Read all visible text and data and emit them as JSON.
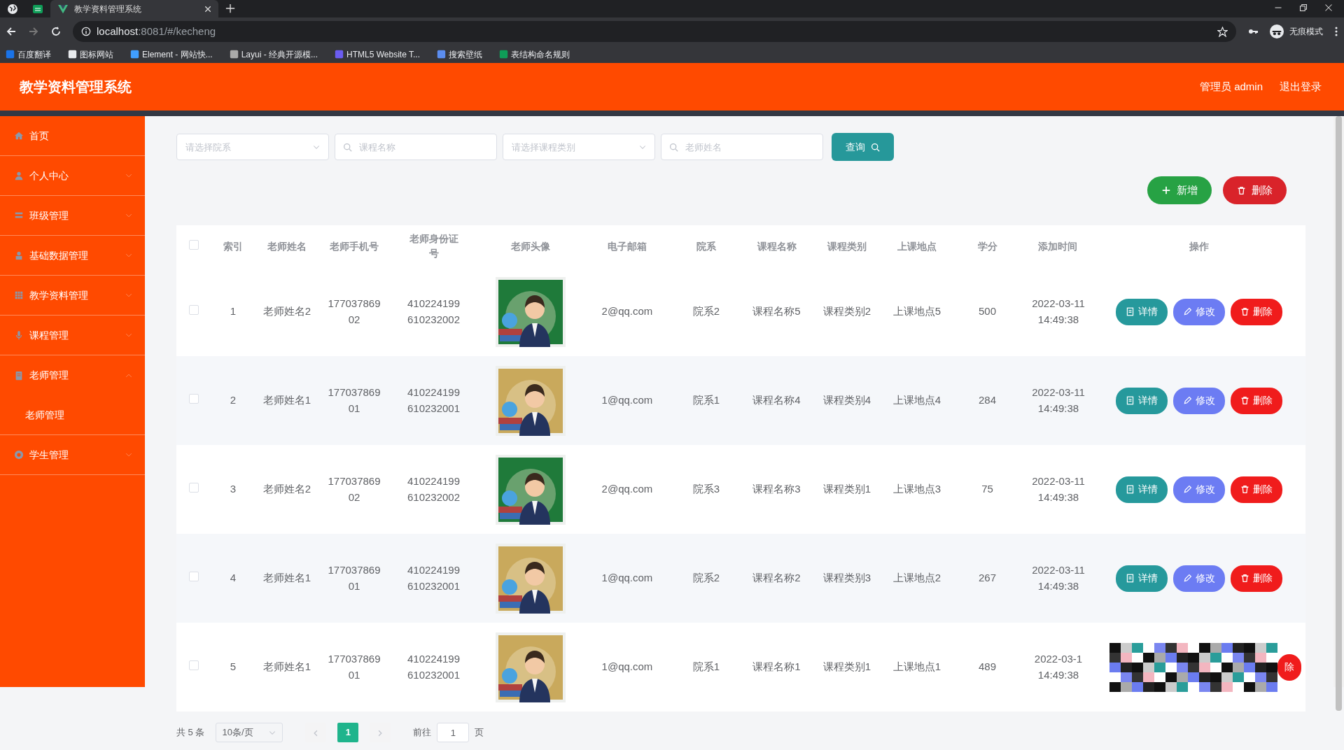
{
  "browser": {
    "tabs": [
      {
        "kind": "pinned",
        "selected": false
      },
      {
        "kind": "pinned",
        "selected": false
      },
      {
        "kind": "page",
        "title": "教学资料管理系统",
        "selected": true
      }
    ],
    "url_host": "localhost",
    "url_path": ":8081/#/kecheng",
    "profile": "无痕模式",
    "bookmarks": [
      "百度翻译",
      "图标网站",
      "Element - 网站快...",
      "Layui - 经典开源模...",
      "HTML5 Website T...",
      "搜索壁纸",
      "表结构命名规则"
    ]
  },
  "app": {
    "title": "教学资料管理系统",
    "user": "管理员 admin",
    "logout": "退出登录"
  },
  "sidebar": {
    "items": [
      {
        "label": "首页",
        "kind": "link"
      },
      {
        "label": "个人中心",
        "kind": "menu",
        "expanded": false
      },
      {
        "label": "班级管理",
        "kind": "menu",
        "expanded": false
      },
      {
        "label": "基础数据管理",
        "kind": "menu",
        "expanded": false
      },
      {
        "label": "教学资料管理",
        "kind": "menu",
        "expanded": false
      },
      {
        "label": "课程管理",
        "kind": "menu",
        "expanded": false
      },
      {
        "label": "老师管理",
        "kind": "menu",
        "expanded": true,
        "children": [
          {
            "label": "老师管理"
          }
        ]
      },
      {
        "label": "学生管理",
        "kind": "menu",
        "expanded": false
      }
    ]
  },
  "filters": [
    {
      "kind": "select",
      "placeholder": "请选择院系"
    },
    {
      "kind": "search",
      "placeholder": "课程名称"
    },
    {
      "kind": "select",
      "placeholder": "请选择课程类别"
    },
    {
      "kind": "search",
      "placeholder": "老师姓名"
    }
  ],
  "query_button": "查询",
  "toolbar": {
    "add": "新增",
    "delete": "删除"
  },
  "table": {
    "header_checked": false,
    "columns": [
      "索引",
      "老师姓名",
      "老师手机号",
      "老师身份证号",
      "老师头像",
      "电子邮箱",
      "院系",
      "课程名称",
      "课程类别",
      "上课地点",
      "学分",
      "添加时间",
      "操作"
    ],
    "rows": [
      {
        "checked": false,
        "index": "1",
        "name": "老师姓名2",
        "phone": "17703786902",
        "id_card": "410224199610232002",
        "avatar": {
          "kind": "picture",
          "color": "#1f7a3a"
        },
        "email": "2@qq.com",
        "department": "院系2",
        "course_name": "课程名称5",
        "course_type": "课程类别2",
        "location": "上课地点5",
        "credits": "500",
        "added": "2022-03-11 14:49:38",
        "actions": [
          {
            "kind": "detail",
            "label": "详情"
          },
          {
            "kind": "edit",
            "label": "修改"
          },
          {
            "kind": "delete",
            "label": "删除"
          }
        ]
      },
      {
        "checked": false,
        "index": "2",
        "name": "老师姓名1",
        "phone": "17703786901",
        "id_card": "410224199610232001",
        "avatar": {
          "kind": "picture",
          "color": "#c9a95c"
        },
        "email": "1@qq.com",
        "department": "院系1",
        "course_name": "课程名称4",
        "course_type": "课程类别4",
        "location": "上课地点4",
        "credits": "284",
        "added": "2022-03-11 14:49:38",
        "actions": [
          {
            "kind": "detail",
            "label": "详情"
          },
          {
            "kind": "edit",
            "label": "修改"
          },
          {
            "kind": "delete",
            "label": "删除"
          }
        ]
      },
      {
        "checked": false,
        "index": "3",
        "name": "老师姓名2",
        "phone": "17703786902",
        "id_card": "410224199610232002",
        "avatar": {
          "kind": "picture",
          "color": "#1f7a3a"
        },
        "email": "2@qq.com",
        "department": "院系3",
        "course_name": "课程名称3",
        "course_type": "课程类别1",
        "location": "上课地点3",
        "credits": "75",
        "added": "2022-03-11 14:49:38",
        "actions": [
          {
            "kind": "detail",
            "label": "详情"
          },
          {
            "kind": "edit",
            "label": "修改"
          },
          {
            "kind": "delete",
            "label": "删除"
          }
        ]
      },
      {
        "checked": false,
        "index": "4",
        "name": "老师姓名1",
        "phone": "17703786901",
        "id_card": "410224199610232001",
        "avatar": {
          "kind": "picture",
          "color": "#c9a95c"
        },
        "email": "1@qq.com",
        "department": "院系2",
        "course_name": "课程名称2",
        "course_type": "课程类别3",
        "location": "上课地点2",
        "credits": "267",
        "added": "2022-03-11 14:49:38",
        "actions": [
          {
            "kind": "detail",
            "label": "详情"
          },
          {
            "kind": "edit",
            "label": "修改"
          },
          {
            "kind": "delete",
            "label": "删除"
          }
        ]
      },
      {
        "checked": false,
        "index": "5",
        "name": "老师姓名1",
        "phone": "17703786901",
        "id_card": "410224199610232001",
        "avatar": {
          "kind": "picture",
          "color": "#c9a95c"
        },
        "email": "1@qq.com",
        "department": "院系1",
        "course_name": "课程名称1",
        "course_type": "课程类别1",
        "location": "上课地点1",
        "credits": "489",
        "added": "2022-03-1 14:49:38",
        "obscured": true,
        "actions": [
          {
            "kind": "delete",
            "label": "除"
          }
        ]
      }
    ]
  },
  "pagination": {
    "total": "共 5 条",
    "page_size": "10条/页",
    "pages": [
      {
        "label": "1",
        "selected": true
      }
    ],
    "goto_label": "前往",
    "goto_value": "1",
    "goto_suffix": "页"
  }
}
